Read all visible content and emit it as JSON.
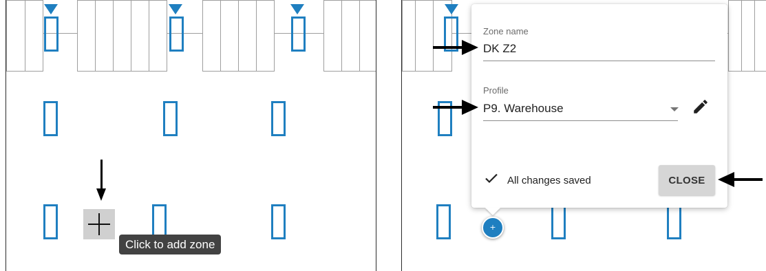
{
  "left_panel": {
    "add_zone_tooltip": "Click to add zone",
    "add_zone_icon": "plus-icon"
  },
  "dialog": {
    "zone_name_label": "Zone name",
    "zone_name_value": "DK Z2",
    "profile_label": "Profile",
    "profile_value": "P9. Warehouse",
    "profile_dropdown_icon": "caret-down-icon",
    "edit_icon": "pencil-icon",
    "status_icon": "check-icon",
    "status_text": "All changes saved",
    "close_label": "CLOSE"
  },
  "right_panel": {
    "add_zone_fab_label": "+"
  },
  "colors": {
    "zone_blue": "#1f7fc0",
    "shelf_gray": "#9e9e9e",
    "tooltip_bg": "#424242",
    "close_button_bg": "#d6d6d6",
    "arrow_black": "#000000"
  }
}
